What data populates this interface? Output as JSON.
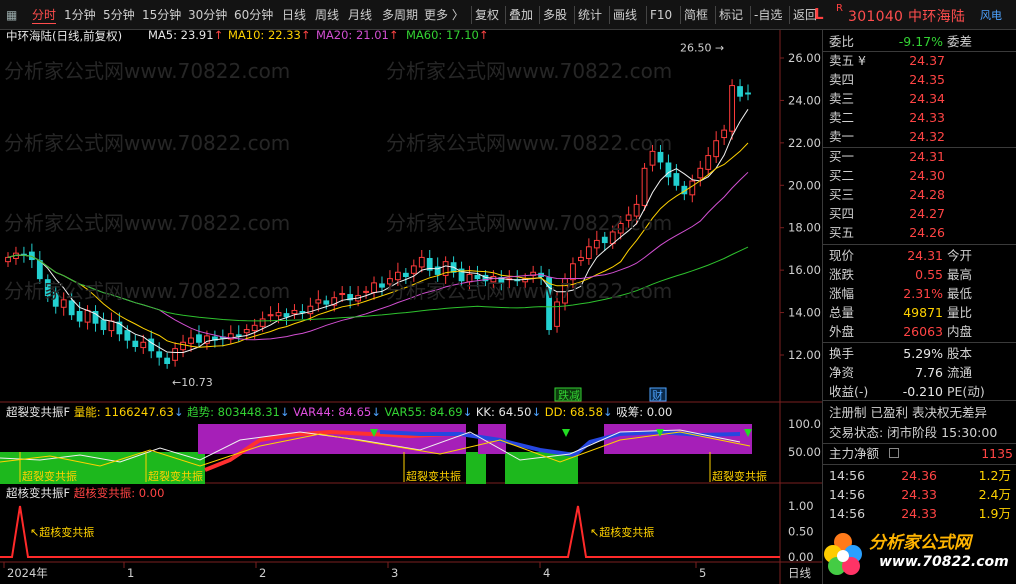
{
  "toolbar": {
    "items": [
      {
        "label": "分时",
        "active": true
      },
      {
        "label": "1分钟"
      },
      {
        "label": "5分钟"
      },
      {
        "label": "15分钟"
      },
      {
        "label": "30分钟"
      },
      {
        "label": "60分钟"
      },
      {
        "label": "日线"
      },
      {
        "label": "周线"
      },
      {
        "label": "月线"
      },
      {
        "label": "多周期"
      },
      {
        "label": "更多 〉"
      }
    ],
    "tools": [
      "复权",
      "叠加",
      "多股",
      "统计",
      "画线",
      "F10",
      "简框",
      "标记",
      "-自选",
      "返回"
    ]
  },
  "stock_header": {
    "market": "L",
    "r_mark": "R",
    "code_name": "301040 中环海陆",
    "elec_label": "风电"
  },
  "main_chart": {
    "legend": {
      "name": "中环海陆(日线,前复权)",
      "ma5": "MA5: 23.91",
      "ma10": "MA10: 22.33",
      "ma20": "MA20: 21.01",
      "ma60": "MA60: 17.10"
    },
    "y_ticks": [
      "26.00",
      "24.00",
      "22.00",
      "20.00",
      "18.00",
      "16.00",
      "14.00",
      "12.00"
    ],
    "high_mark": "26.50",
    "low_mark": "10.73",
    "event_tags": [
      "跌减",
      "财"
    ],
    "watermark": "分析家公式网www.70822.com"
  },
  "indicator1": {
    "legend": {
      "name": "超裂变共振F",
      "energy": "量能: 1166247.63",
      "trend": "趋势: 803448.31",
      "var44": "VAR44: 84.65",
      "var55": "VAR55: 84.69",
      "kk": "KK: 64.50",
      "dd": "DD: 68.58",
      "xichou": "吸筹: 0.00"
    },
    "y_ticks": [
      "100.0",
      "50.00"
    ],
    "signal_label": "超裂变共振"
  },
  "indicator2": {
    "legend": {
      "name": "超核变共振F",
      "value": "超核变共振: 0.00"
    },
    "y_ticks": [
      "1.00",
      "0.50",
      "0.00"
    ],
    "signal_label": "超核变共振"
  },
  "time_axis": {
    "labels": [
      "2024年",
      "1",
      "2",
      "3",
      "4",
      "5"
    ],
    "period": "日线"
  },
  "quote_panel": {
    "webi": {
      "label": "委比",
      "value": "-9.17%",
      "label2": "委差"
    },
    "asks": [
      {
        "label": "卖五 ¥",
        "price": "24.37"
      },
      {
        "label": "卖四",
        "price": "24.35"
      },
      {
        "label": "卖三",
        "price": "24.34"
      },
      {
        "label": "卖二",
        "price": "24.33"
      },
      {
        "label": "卖一",
        "price": "24.32"
      }
    ],
    "bids": [
      {
        "label": "买一",
        "price": "24.31"
      },
      {
        "label": "买二",
        "price": "24.30"
      },
      {
        "label": "买三",
        "price": "24.28"
      },
      {
        "label": "买四",
        "price": "24.27"
      },
      {
        "label": "买五",
        "price": "24.26"
      }
    ],
    "stats": [
      {
        "label": "现价",
        "value": "24.31",
        "label2": "今开"
      },
      {
        "label": "涨跌",
        "value": "0.55",
        "label2": "最高"
      },
      {
        "label": "涨幅",
        "value": "2.31%",
        "label2": "最低"
      },
      {
        "label": "总量",
        "value": "49871",
        "label2": "量比"
      },
      {
        "label": "外盘",
        "value": "26063",
        "label2": "内盘"
      }
    ],
    "stats2": [
      {
        "label": "换手",
        "value": "5.29%",
        "label2": "股本"
      },
      {
        "label": "净资",
        "value": "7.76",
        "label2": "流通"
      },
      {
        "label": "收益(-)",
        "value": "-0.210",
        "label2": "PE(动)"
      }
    ],
    "reg_line": "注册制 已盈利 表决权无差异",
    "trade_status": "交易状态: 闭市阶段 15:30:00",
    "net_label": "主力净额",
    "net_value": "1135",
    "ticks": [
      {
        "time": "14:56",
        "price": "24.36",
        "vol": "1.2万"
      },
      {
        "time": "14:56",
        "price": "24.33",
        "vol": "2.4万"
      },
      {
        "time": "14:56",
        "price": "24.33",
        "vol": "1.9万"
      }
    ],
    "logo_text": "分析家公式网",
    "logo_url": "www.70822.com"
  }
}
